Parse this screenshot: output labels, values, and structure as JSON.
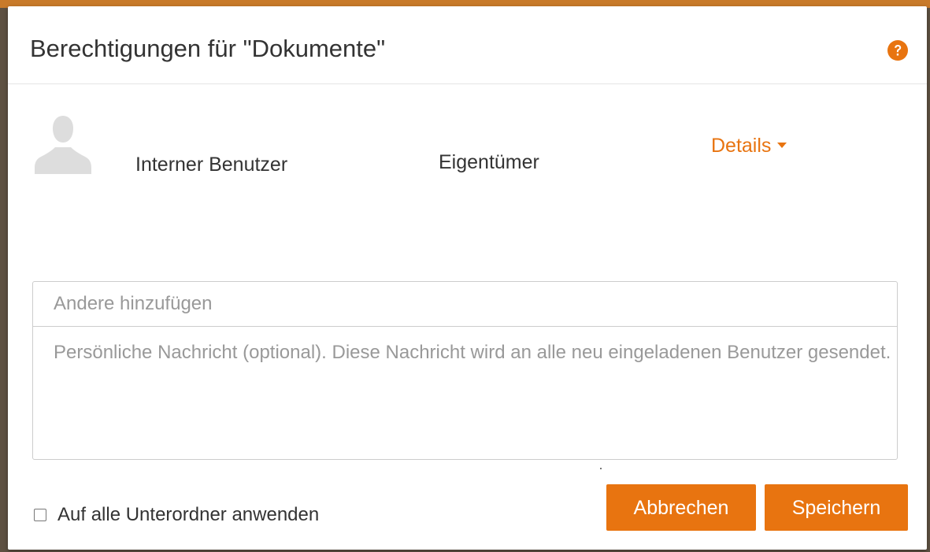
{
  "dialog": {
    "title": "Berechtigungen für \"Dokumente\"",
    "help_icon": "question-circle-icon"
  },
  "permissions": {
    "rows": [
      {
        "avatar_icon": "user-silhouette-icon",
        "name": "Interner Benutzer",
        "role": "Eigentümer",
        "details_label": "Details"
      }
    ]
  },
  "form": {
    "add_placeholder": "Andere hinzufügen",
    "message_placeholder": "Persönliche Nachricht (optional). Diese Nachricht wird an alle neu eingeladenen Benutzer gesendet."
  },
  "footer": {
    "apply_subfolders_label": "Auf alle Unterordner anwenden",
    "apply_subfolders_checked": false,
    "cancel_label": "Abbrechen",
    "save_label": "Speichern"
  },
  "colors": {
    "accent": "#e87410",
    "text": "#333333",
    "placeholder": "#999999"
  }
}
